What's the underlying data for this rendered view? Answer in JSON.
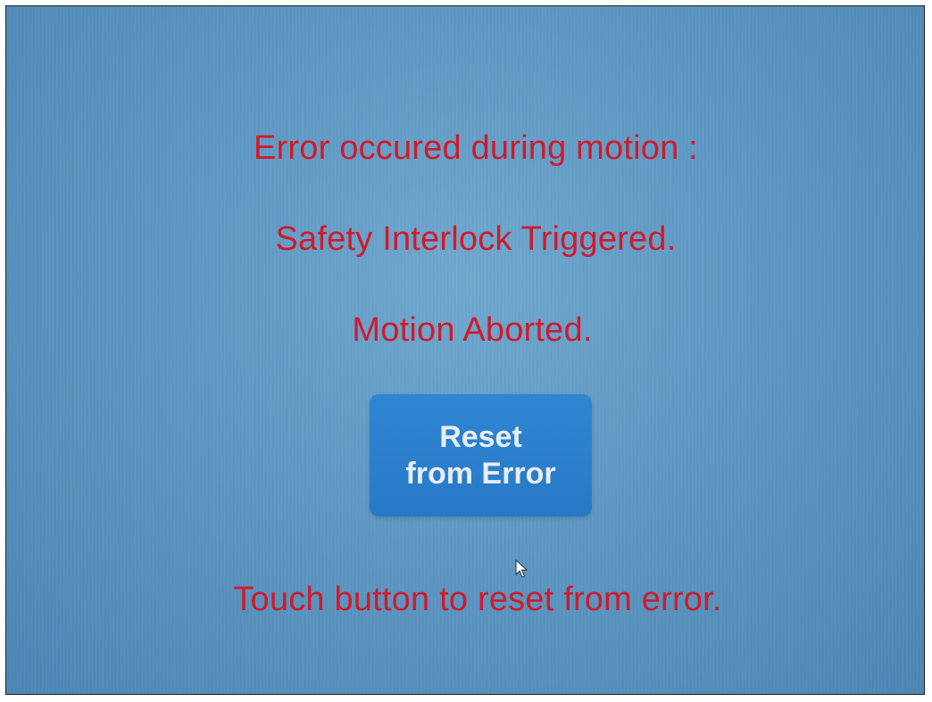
{
  "dialog": {
    "error_heading": "Error occured during motion :",
    "error_reason": "Safety Interlock Triggered.",
    "error_status": "Motion Aborted.",
    "reset_button": {
      "line1": "Reset",
      "line2": "from Error"
    },
    "instruction": "Touch button to reset from error."
  },
  "colors": {
    "message_text": "#d11a2a",
    "button_bg": "#2f86d3",
    "button_text": "#e8eef5",
    "screen_bg": "#5d97c2"
  },
  "icons": {
    "cursor": "mouse-pointer-icon"
  }
}
